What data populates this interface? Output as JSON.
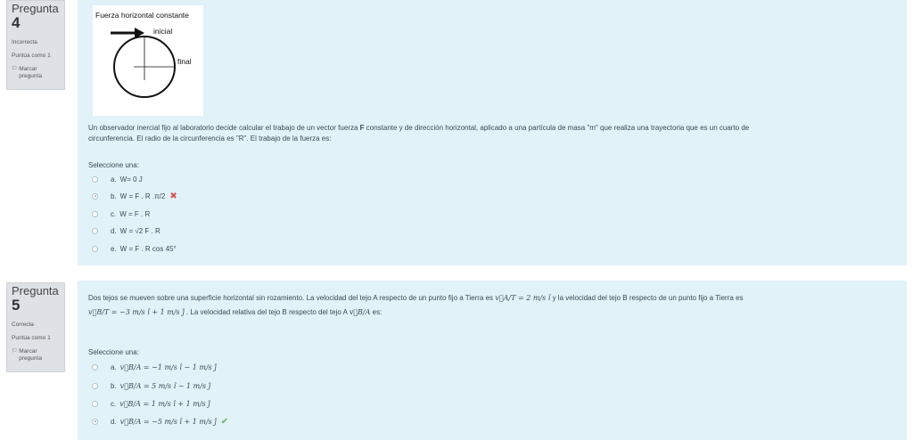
{
  "q4": {
    "label": "Pregunta",
    "number": "4",
    "state": "Incorrecta",
    "points": "Puntúa como 1",
    "flag": "Marcar pregunta",
    "figure": {
      "title": "Fuerza horizontal constante",
      "inicial": "inicial",
      "final": "final"
    },
    "text_line1": "Un observador inercial fijo al laboratorio decide calcular el trabajo de un vector fuerza",
    "text_bold": "F",
    "text_line1b": "constante y de dirección horizontal, aplicado a una partícula de masa \"m\" que realiza una trayectoria que es un cuarto de",
    "text_line2": "circunferencia. El radio de la circunferencia es \"R\". El trabajo de la fuerza es:",
    "select": "Seleccione una:",
    "options": [
      {
        "letter": "a.",
        "text": "W= 0 J"
      },
      {
        "letter": "b.",
        "text": "W = F . R .π/2"
      },
      {
        "letter": "c.",
        "text": "W = F . R"
      },
      {
        "letter": "d.",
        "text": "W = √2 F . R"
      },
      {
        "letter": "e.",
        "text": "W = F . R cos 45°"
      }
    ],
    "selected": 1,
    "wrong_mark": "✖"
  },
  "q5": {
    "label": "Pregunta",
    "number": "5",
    "state": "Correcta",
    "points": "Puntúa como 1",
    "flag": "Marcar pregunta",
    "text_line1a": "Dos tejos se mueven sobre una superficie horizontal sin rozamiento. La velocidad del tejo A respecto de un punto fijo a Tierra es",
    "math_vat": "v⃗A/T = 2 m/s î",
    "text_line1b": "y la velocidad del tejo B respecto de un punto fijo a Tierra es",
    "math_vbt": "v⃗B/T = −3 m/s î + 1 m/s ĵ",
    "text_line2": ". La velocidad relativa del tejo B respecto del tejo A",
    "math_vba": "v⃗B/A",
    "text_line2b": "es:",
    "select": "Seleccione una:",
    "options": [
      {
        "letter": "a.",
        "text": "v⃗B/A = −1 m/s î − 1 m/s ĵ"
      },
      {
        "letter": "b.",
        "text": "v⃗B/A = 5 m/s î − 1 m/s ĵ"
      },
      {
        "letter": "c.",
        "text": "v⃗B/A = 1 m/s î + 1 m/s ĵ"
      },
      {
        "letter": "d.",
        "text": "v⃗B/A = −5 m/s î + 1 m/s ĵ"
      }
    ],
    "selected": 3,
    "right_mark": "✔"
  }
}
